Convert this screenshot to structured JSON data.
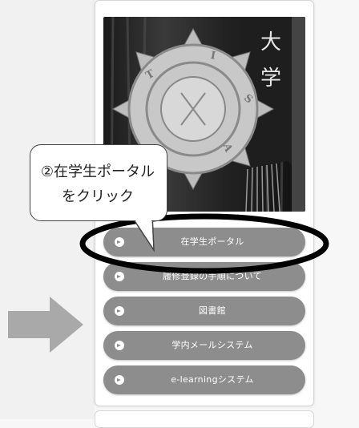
{
  "menu": {
    "items": [
      {
        "label": "在学生ポータル"
      },
      {
        "label": "履修登録の手順について"
      },
      {
        "label": "図書館"
      },
      {
        "label": "学内メールシステム"
      },
      {
        "label": "e-learningシステム"
      }
    ]
  },
  "callout": {
    "line1": "②在学生ポータル",
    "line2": "をクリック"
  },
  "photo": {
    "banner_text": "大学"
  },
  "colors": {
    "button_bg": "#8d8d8d",
    "arrow": "#a9a9a9",
    "highlight_ellipse": "#000000"
  },
  "icons": {
    "menu_bullet": "chevron-circle-right-icon",
    "pointer": "right-arrow-icon"
  }
}
